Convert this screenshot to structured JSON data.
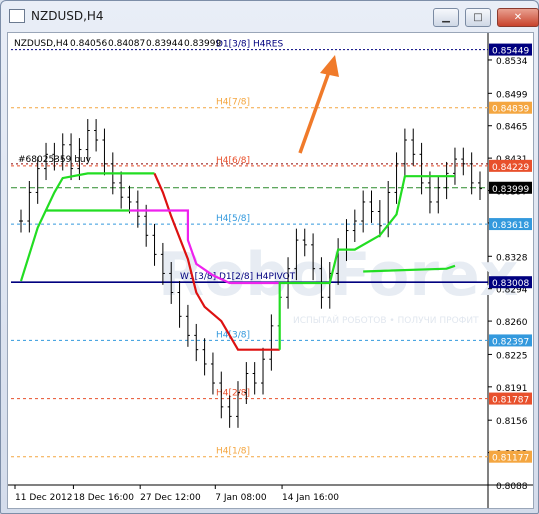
{
  "window": {
    "title": "NZDUSD,H4"
  },
  "title_buttons": {
    "minimize": "▁",
    "maximize": "□",
    "close": "✕"
  },
  "chart_data": {
    "type": "line",
    "header": {
      "symbol": "NZDUSD,H4",
      "ohlc": [
        "0.84056",
        "0.84087",
        "0.83944",
        "0.83999"
      ]
    },
    "ylim": [
      0.8088,
      0.8556
    ],
    "y_ticks": [
      0.8534,
      0.8499,
      0.8465,
      0.8431,
      0.8397,
      0.8363,
      0.8328,
      0.8294,
      0.826,
      0.8225,
      0.8191,
      0.8156,
      0.8122,
      0.8088
    ],
    "x_tick_labels": [
      "11 Dec 2012",
      "18 Dec 16:00",
      "27 Dec 12:00",
      "7 Jan 08:00",
      "14 Jan 16:00"
    ],
    "levels": [
      {
        "label": "D1[3/8] H4RES",
        "value": 0.85449,
        "price_label": "0.85449",
        "color": "#00007f"
      },
      {
        "label": "H4[7/8]",
        "value": 0.84839,
        "price_label": "0.84839",
        "color": "#f4a640"
      },
      {
        "label": "H4[6/8]",
        "value": 0.84229,
        "price_label": "0.84229",
        "color": "#e8502c"
      },
      {
        "label": "H4[5/8]",
        "value": 0.83618,
        "price_label": "0.83618",
        "color": "#3399dd"
      },
      {
        "label": "W1[3/8] D1[2/8] H4PIVOT",
        "value": 0.83008,
        "price_label": "0.83008",
        "color": "#00007f"
      },
      {
        "label": "H4[3/8]",
        "value": 0.82397,
        "price_label": "0.82397",
        "color": "#3399dd"
      },
      {
        "label": "H4[2/8]",
        "value": 0.81787,
        "price_label": "0.81787",
        "color": "#e8502c"
      },
      {
        "label": "H4[1/8]",
        "value": 0.81177,
        "price_label": "0.81177",
        "color": "#f4a640"
      }
    ],
    "current_price": {
      "value": 0.83999,
      "label": "0.83999"
    },
    "order_label": "#68025359 buy",
    "watermark": {
      "title": "RoboForex",
      "subtitle": "ИСПЫТАЙ РОБОТОВ • ПОЛУЧИ ПРОФИТ"
    },
    "price_series": {
      "name": "NZDUSD,H4",
      "values": [
        0.8365,
        0.8395,
        0.842,
        0.8435,
        0.843,
        0.8445,
        0.842,
        0.844,
        0.846,
        0.845,
        0.8425,
        0.8405,
        0.839,
        0.8385,
        0.837,
        0.835,
        0.833,
        0.831,
        0.829,
        0.8265,
        0.8245,
        0.823,
        0.8215,
        0.8195,
        0.817,
        0.816,
        0.8185,
        0.8205,
        0.8195,
        0.822,
        0.8255,
        0.8285,
        0.8315,
        0.8345,
        0.834,
        0.8315,
        0.8285,
        0.831,
        0.8335,
        0.8355,
        0.8365,
        0.8385,
        0.8375,
        0.836,
        0.8395,
        0.8425,
        0.845,
        0.8435,
        0.8405,
        0.8385,
        0.84,
        0.8415,
        0.843,
        0.8425,
        0.8405,
        0.8399
      ]
    },
    "indicator_lines": [
      {
        "color": "#22dd22",
        "points": [
          [
            0,
            0.8302
          ],
          [
            2,
            0.8358
          ],
          [
            4,
            0.8395
          ],
          [
            5,
            0.841
          ],
          [
            8,
            0.8415
          ],
          [
            16,
            0.8415
          ]
        ]
      },
      {
        "color": "#22dd22",
        "points": [
          [
            3,
            0.8376
          ],
          [
            13,
            0.8376
          ]
        ]
      },
      {
        "color": "#dd1111",
        "points": [
          [
            16,
            0.8415
          ],
          [
            17,
            0.8395
          ],
          [
            18,
            0.837
          ],
          [
            20,
            0.8325
          ],
          [
            21,
            0.829
          ],
          [
            22,
            0.8275
          ],
          [
            24,
            0.826
          ],
          [
            26,
            0.823
          ],
          [
            27,
            0.823
          ],
          [
            28,
            0.823
          ],
          [
            31,
            0.823
          ]
        ]
      },
      {
        "color": "#ee22ee",
        "points": [
          [
            13,
            0.8376
          ],
          [
            20,
            0.8376
          ],
          [
            20,
            0.8345
          ],
          [
            21,
            0.832
          ],
          [
            23,
            0.8308
          ],
          [
            25,
            0.83
          ],
          [
            31,
            0.83
          ]
        ]
      },
      {
        "color": "#22dd22",
        "points": [
          [
            31,
            0.823
          ],
          [
            31,
            0.83
          ],
          [
            37,
            0.83
          ],
          [
            38,
            0.8335
          ],
          [
            40,
            0.8335
          ],
          [
            43,
            0.835
          ],
          [
            45,
            0.8372
          ],
          [
            46,
            0.8412
          ],
          [
            48,
            0.8412
          ],
          [
            52,
            0.8412
          ]
        ]
      },
      {
        "color": "#22dd22",
        "points": [
          [
            41,
            0.8312
          ],
          [
            51,
            0.8315
          ],
          [
            52,
            0.8318
          ]
        ]
      }
    ],
    "x_count": 56,
    "grid": false
  }
}
